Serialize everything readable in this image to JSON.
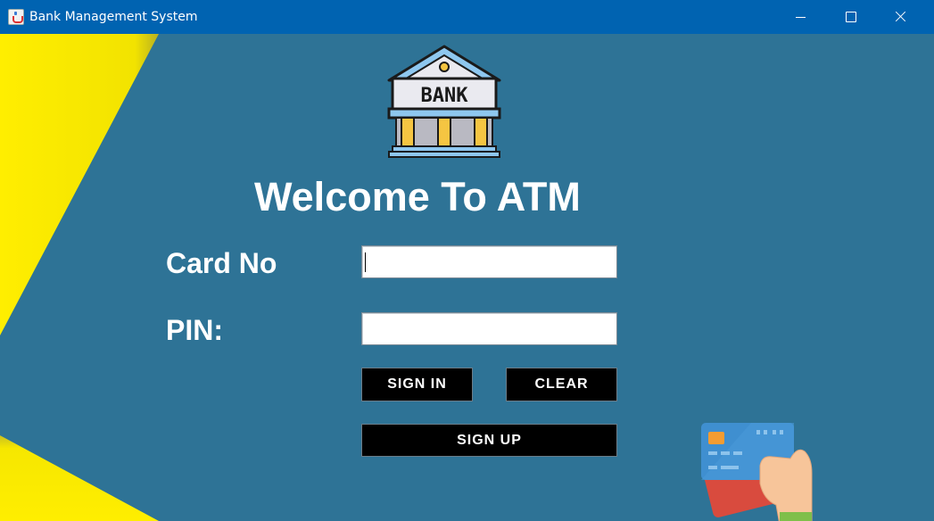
{
  "window": {
    "title": "Bank Management System",
    "icon": "java-coffee-cup-icon"
  },
  "header": {
    "logo_icon": "bank-building-icon",
    "logo_text": "BANK",
    "title": "Welcome To ATM"
  },
  "form": {
    "card_label": "Card No",
    "card_value": "",
    "pin_label": "PIN:",
    "pin_value": ""
  },
  "buttons": {
    "sign_in": "SIGN IN",
    "clear": "CLEAR",
    "sign_up": "SIGN UP"
  },
  "decoration": {
    "card_icon": "credit-card-in-hand-icon"
  },
  "colors": {
    "titlebar": "#0063b1",
    "background": "#2e7396",
    "accent_yellow": "#ffee00",
    "button_bg": "#000000",
    "text": "#ffffff"
  }
}
